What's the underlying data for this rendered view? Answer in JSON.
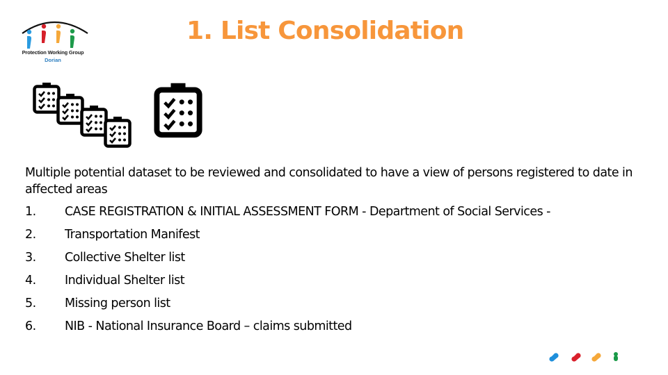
{
  "logo": {
    "line1": "Protection Working Group",
    "line2": "Dorian",
    "figure_colors": [
      "#2a9be0",
      "#d6202a",
      "#f5a83a",
      "#1d9a4a"
    ],
    "icon": "protection-working-group-logo"
  },
  "title": "1. List Consolidation",
  "title_color": "#f7963b",
  "icons": {
    "multiple_lists": "stacked-clipboard-checklist-icons",
    "single_list": "clipboard-checklist-icon"
  },
  "intro": "Multiple potential dataset to be reviewed and consolidated to have a view of persons registered to date in affected areas",
  "items": [
    {
      "num": "1.",
      "text": "CASE REGISTRATION & INITIAL ASSESSMENT FORM - Department of Social Services -"
    },
    {
      "num": "2.",
      "text": "Transportation Manifest"
    },
    {
      "num": "3.",
      "text": "Collective Shelter list"
    },
    {
      "num": "4.",
      "text": "Individual Shelter list"
    },
    {
      "num": "5.",
      "text": "Missing person list"
    },
    {
      "num": "6.",
      "text": "NIB - National Insurance Board – claims submitted"
    }
  ],
  "footer_dots": [
    "#1f8fdb",
    "#d9202c",
    "#f5a83a",
    "#1a9a48"
  ]
}
